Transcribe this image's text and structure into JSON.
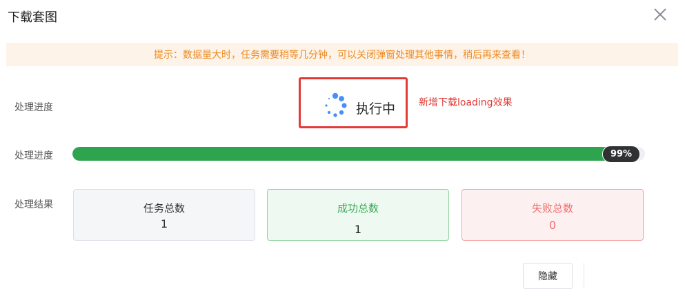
{
  "dialog": {
    "title": "下载套图",
    "close_icon": "close-icon"
  },
  "notice": {
    "text": "提示：数据量大时，任务需要稍等几分钟，可以关闭弹窗处理其他事情，稍后再来查看！"
  },
  "status_row": {
    "label": "处理进度",
    "spinner_icon": "loading-spinner-icon",
    "status": "执行中",
    "annotation": "新增下载loading效果",
    "highlight_color": "#e53935"
  },
  "progress_row": {
    "label": "处理进度",
    "percent": 99,
    "percent_text": "99%",
    "bar_color": "#2ea44f"
  },
  "result_row": {
    "label": "处理结果",
    "cards": [
      {
        "title": "任务总数",
        "value": "1",
        "color": "#303133"
      },
      {
        "title": "成功总数",
        "value": "1",
        "color": "#3aaa54"
      },
      {
        "title": "失败总数",
        "value": "0",
        "color": "#f56c6c"
      }
    ]
  },
  "footer": {
    "hide_label": "隐藏"
  }
}
